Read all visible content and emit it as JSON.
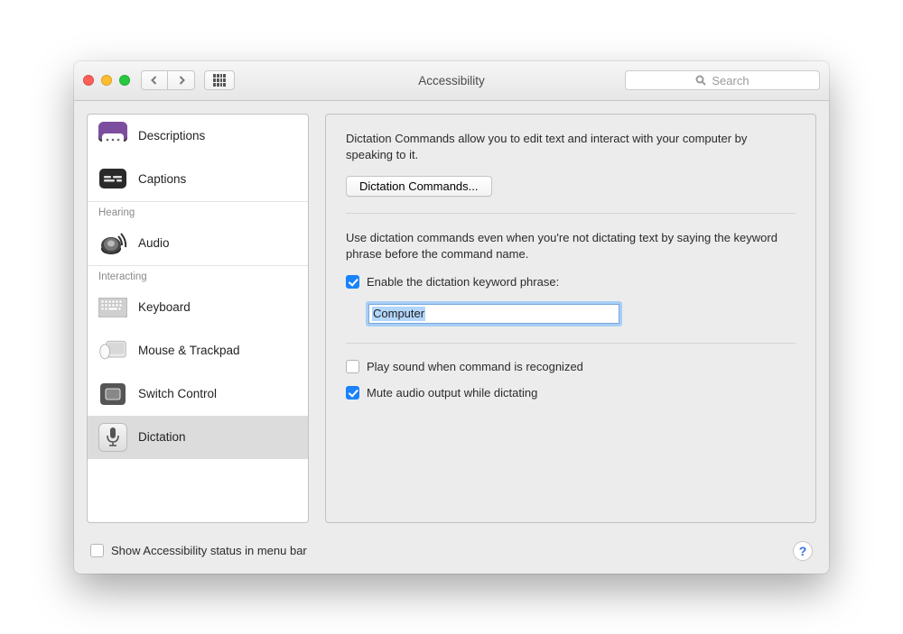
{
  "window": {
    "title": "Accessibility",
    "search_placeholder": "Search"
  },
  "sidebar": {
    "items": [
      {
        "label": "Descriptions"
      },
      {
        "label": "Captions"
      }
    ],
    "hearing_header": "Hearing",
    "hearing_items": [
      {
        "label": "Audio"
      }
    ],
    "interacting_header": "Interacting",
    "interacting_items": [
      {
        "label": "Keyboard"
      },
      {
        "label": "Mouse & Trackpad"
      },
      {
        "label": "Switch Control"
      },
      {
        "label": "Dictation"
      }
    ]
  },
  "main": {
    "intro": "Dictation Commands allow you to edit text and interact with your computer by speaking to it.",
    "commands_button": "Dictation Commands...",
    "use_commands_text": "Use dictation commands even when you're not dictating text by saying the keyword phrase before the command name.",
    "enable_keyword_label": "Enable the dictation keyword phrase:",
    "keyword_value": "Computer",
    "play_sound_label": "Play sound when command is recognized",
    "mute_audio_label": "Mute audio output while dictating"
  },
  "footer": {
    "status_label": "Show Accessibility status in menu bar"
  },
  "checkbox_state": {
    "enable_keyword": true,
    "play_sound": false,
    "mute_audio": true,
    "show_status": false
  }
}
